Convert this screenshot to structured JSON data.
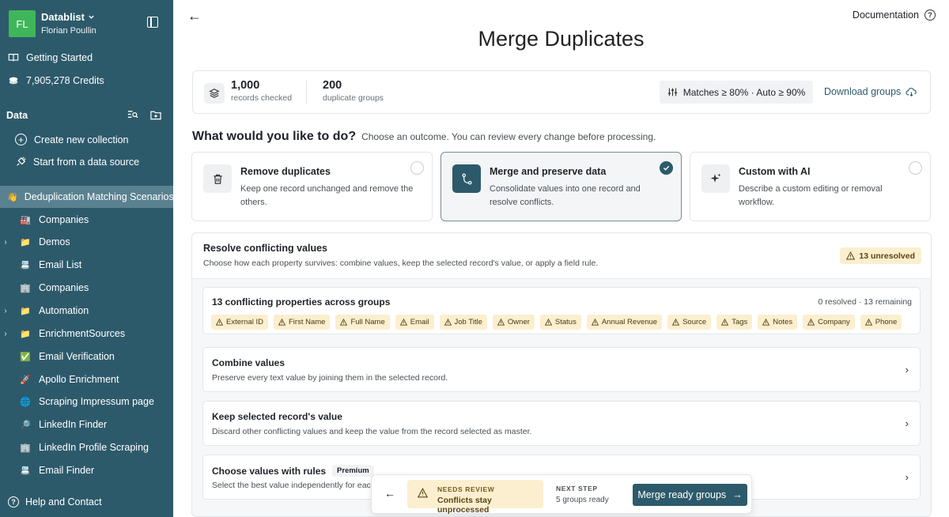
{
  "workspace": {
    "initials": "FL",
    "name": "Datablist",
    "user": "Florian Poullin"
  },
  "top_nav": [
    {
      "label": "Getting Started"
    },
    {
      "label": "7,905,278 Credits"
    }
  ],
  "sidebar": {
    "section": "Data",
    "actions": [
      {
        "label": "Create new collection"
      },
      {
        "label": "Start from a data source"
      }
    ],
    "items": [
      {
        "emoji": "👋",
        "label": "Deduplication Matching Scenarios",
        "caret": ""
      },
      {
        "emoji": "🏭",
        "label": "Companies",
        "caret": ""
      },
      {
        "emoji": "📁",
        "label": "Demos",
        "caret": "›"
      },
      {
        "emoji": "📇",
        "label": "Email List",
        "caret": ""
      },
      {
        "emoji": "🏢",
        "label": "Companies",
        "caret": ""
      },
      {
        "emoji": "📁",
        "label": "Automation",
        "caret": "›"
      },
      {
        "emoji": "📁",
        "label": "EnrichmentSources",
        "caret": "›"
      },
      {
        "emoji": "✅",
        "label": "Email Verification",
        "caret": ""
      },
      {
        "emoji": "🚀",
        "label": "Apollo Enrichment",
        "caret": ""
      },
      {
        "emoji": "🌐",
        "label": "Scraping Impressum page",
        "caret": ""
      },
      {
        "emoji": "🔎",
        "label": "LinkedIn Finder",
        "caret": ""
      },
      {
        "emoji": "🏢",
        "label": "LinkedIn Profile Scraping",
        "caret": ""
      },
      {
        "emoji": "📇",
        "label": "Email Finder",
        "caret": ""
      }
    ],
    "help": "Help and Contact"
  },
  "header": {
    "documentation": "Documentation",
    "title": "Merge Duplicates"
  },
  "stats": {
    "records_num": "1,000",
    "records_lbl": "records checked",
    "groups_num": "200",
    "groups_lbl": "duplicate groups",
    "matches": "Matches ≥ 80% · Auto ≥ 90%",
    "download": "Download groups"
  },
  "question": {
    "title": "What would you like to do?",
    "subtitle": "Choose an outcome. You can review every change before processing."
  },
  "outcomes": [
    {
      "title": "Remove duplicates",
      "desc": "Keep one record unchanged and remove the others.",
      "selected": false
    },
    {
      "title": "Merge and preserve data",
      "desc": "Consolidate values into one record and resolve conflicts.",
      "selected": true
    },
    {
      "title": "Custom with AI",
      "desc": "Describe a custom editing or removal workflow.",
      "selected": false
    }
  ],
  "resolve": {
    "title": "Resolve conflicting values",
    "subtitle": "Choose how each property survives: combine values, keep the selected record's value, or apply a field rule.",
    "unresolved": "13 unresolved",
    "conflicts_title": "13 conflicting properties across groups",
    "conflicts_meta": "0 resolved · 13 remaining",
    "properties": [
      "External ID",
      "First Name",
      "Full Name",
      "Email",
      "Job Title",
      "Owner",
      "Status",
      "Annual Revenue",
      "Source",
      "Tags",
      "Notes",
      "Company",
      "Phone"
    ],
    "options": [
      {
        "title": "Combine values",
        "desc": "Preserve every text value by joining them in the selected record.",
        "badge": ""
      },
      {
        "title": "Keep selected record's value",
        "desc": "Discard other conflicting values and keep the value from the record selected as master.",
        "badge": ""
      },
      {
        "title": "Choose values with rules",
        "desc": "Select the best value independently for each",
        "badge": "Premium"
      }
    ]
  },
  "footer": {
    "review_label": "NEEDS REVIEW",
    "review_text": "Conflicts stay unprocessed",
    "next_label": "NEXT STEP",
    "next_text": "5 groups ready",
    "merge_button": "Merge ready groups"
  },
  "colors": {
    "sidebar": "#2d5a6b",
    "accent": "#2d5a6b",
    "warning_bg": "#fbefcf",
    "avatar": "#3fb65b"
  }
}
